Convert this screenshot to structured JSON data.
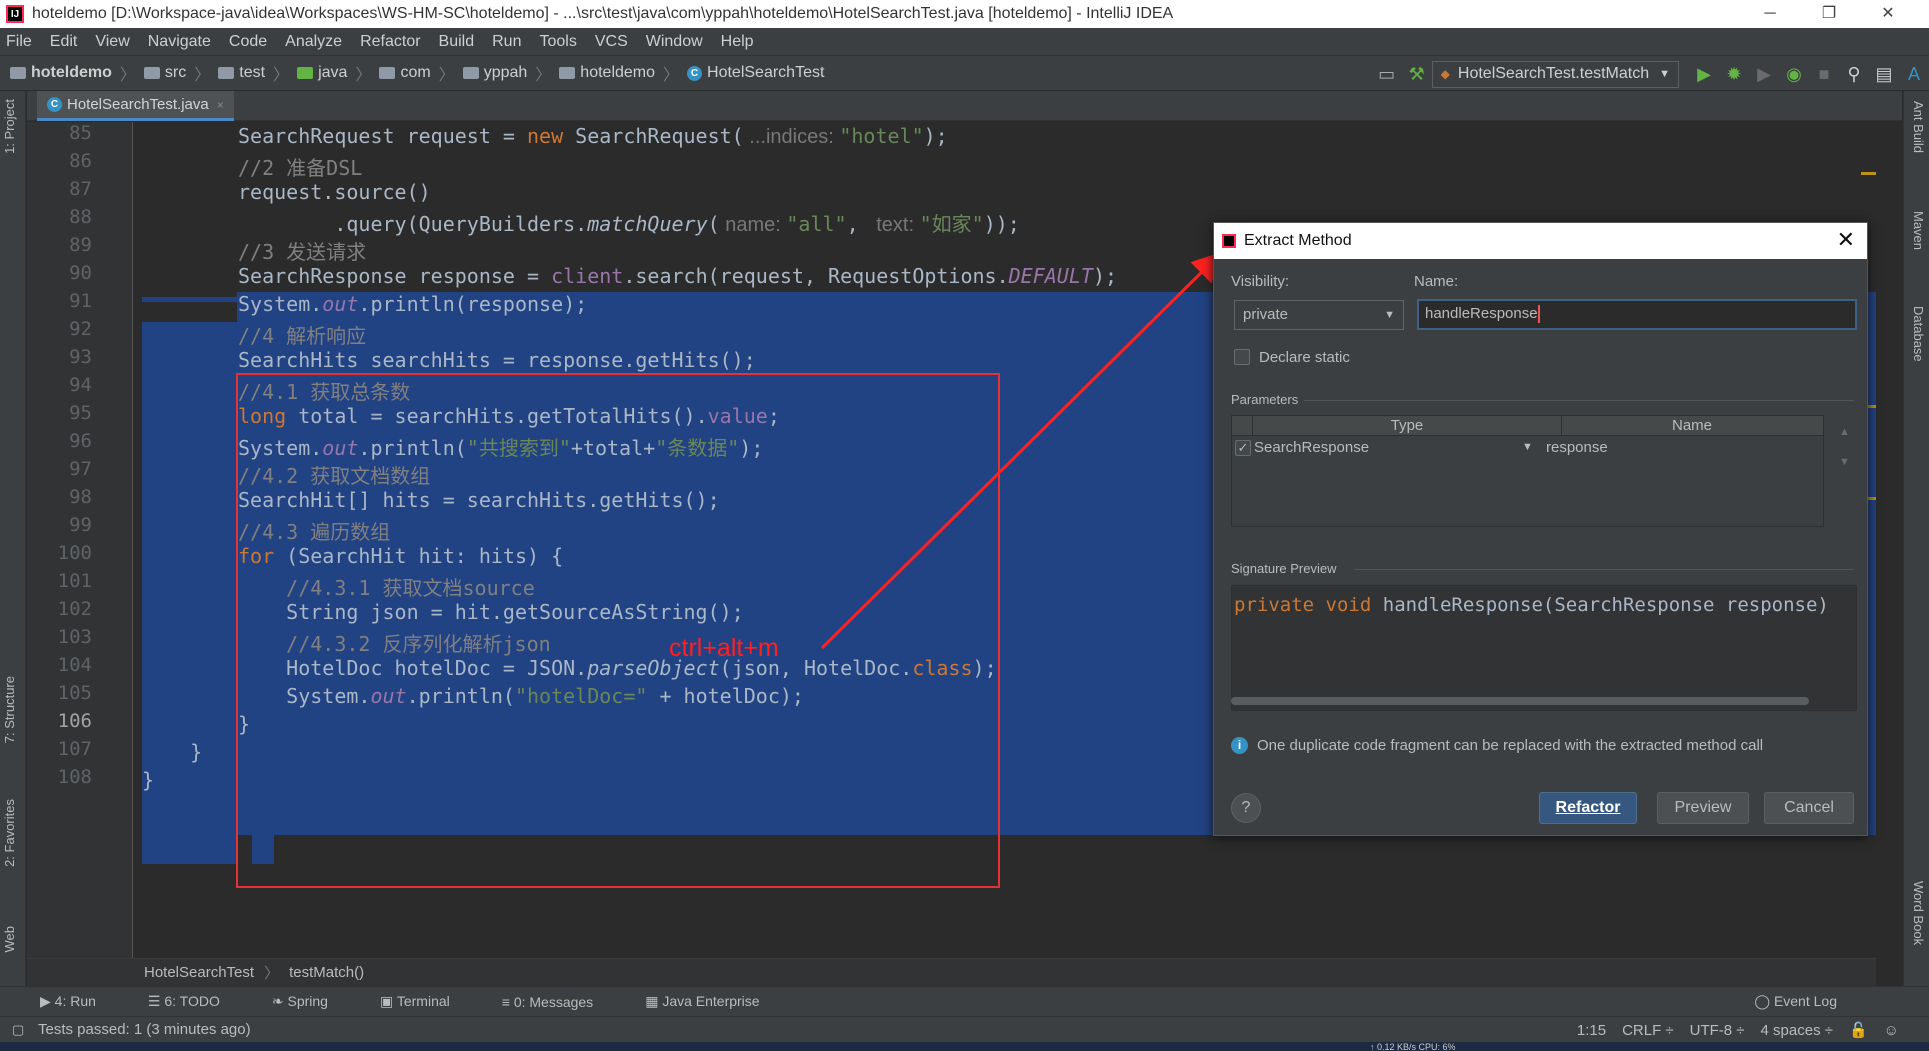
{
  "window": {
    "title": "hoteldemo [D:\\Workspace-java\\idea\\Workspaces\\WS-HM-SC\\hoteldemo] - ...\\src\\test\\java\\com\\yppah\\hoteldemo\\HotelSearchTest.java [hoteldemo] - IntelliJ IDEA",
    "minimize": "─",
    "restore": "❐",
    "close": "✕"
  },
  "menu": [
    "File",
    "Edit",
    "View",
    "Navigate",
    "Code",
    "Analyze",
    "Refactor",
    "Build",
    "Run",
    "Tools",
    "VCS",
    "Window",
    "Help"
  ],
  "breadcrumbs": [
    "hoteldemo",
    "src",
    "test",
    "java",
    "com",
    "yppah",
    "hoteldemo",
    "HotelSearchTest"
  ],
  "run_config": "HotelSearchTest.testMatch",
  "tab": {
    "label": "HotelSearchTest.java",
    "close": "×"
  },
  "left_tool_windows": [
    "1: Project",
    "7: Structure",
    "2: Favorites",
    "Web"
  ],
  "right_tool_windows": [
    "Ant Build",
    "Maven",
    "Database",
    "Word Book"
  ],
  "line_numbers": [
    "85",
    "86",
    "87",
    "88",
    "89",
    "90",
    "91",
    "92",
    "93",
    "94",
    "95",
    "96",
    "97",
    "98",
    "99",
    "100",
    "101",
    "102",
    "103",
    "104",
    "105",
    "106",
    "107",
    "108"
  ],
  "code": {
    "l85": {
      "a": "SearchRequest request = ",
      "kw": "new",
      "b": " SearchRequest(",
      "hint": " ...indices: ",
      "str": "\"hotel\"",
      "c": ");"
    },
    "l86": "//2 准备DSL",
    "l87": "request.source()",
    "l88": {
      "a": "        .query(QueryBuilders.",
      "fn": "matchQuery",
      "b": "(",
      "hint1": " name: ",
      "s1": "\"all\"",
      "c": ", ",
      "hint2": " text: ",
      "s2": "\"如家\"",
      "d": "));"
    },
    "l89": "//3 发送请求",
    "l90": {
      "a": "SearchResponse response = ",
      "fld": "client",
      "b": ".search(request, RequestOptions.",
      "fld2": "DEFAULT",
      "c": ");"
    },
    "l91": {
      "a": "System.",
      "fld": "out",
      "b": ".println(response);"
    },
    "l92": "//4 解析响应",
    "l93": "SearchHits searchHits = response.getHits();",
    "l94": "//4.1 获取总条数",
    "l95": {
      "kw": "long",
      "a": " total = searchHits.getTotalHits().",
      "fld": "value",
      "b": ";"
    },
    "l96": {
      "a": "System.",
      "fld": "out",
      "b": ".println(",
      "s1": "\"共搜索到\"",
      "c": "+total+",
      "s2": "\"条数据\"",
      "d": ");"
    },
    "l97": "//4.2 获取文档数组",
    "l98": "SearchHit[] hits = searchHits.getHits();",
    "l99": "//4.3 遍历数组",
    "l100": {
      "kw": "for",
      "a": " (SearchHit hit: hits) {"
    },
    "l101": "    //4.3.1 获取文档source",
    "l102": "    String json = hit.getSourceAsString();",
    "l103": "    //4.3.2 反序列化解析json",
    "l104": {
      "a": "    HotelDoc hotelDoc = JSON.",
      "fn": "parseObject",
      "b": "(json, HotelDoc.",
      "kw": "class",
      "c": ");"
    },
    "l105": {
      "a": "    System.",
      "fld": "out",
      "b": ".println(",
      "s": "\"hotelDoc=\"",
      "c": " + hotelDoc);"
    },
    "l106": "}",
    "l107": "    }",
    "l108": "}"
  },
  "annotation": "ctrl+alt+m",
  "editor_breadcrumb": [
    "HotelSearchTest",
    "testMatch()"
  ],
  "dialog": {
    "title": "Extract Method",
    "close": "✕",
    "visibility_label": "Visibility:",
    "visibility_value": "private",
    "name_label": "Name:",
    "name_value": "handleResponse",
    "declare_static": "Declare static",
    "parameters_label": "Parameters",
    "col_type": "Type",
    "col_name": "Name",
    "param_type": "SearchResponse",
    "param_name": "response",
    "signature_label": "Signature Preview",
    "signature_kw1": "private",
    "signature_kw2": "void",
    "signature_rest": "handleResponse(SearchResponse response)",
    "info": "One duplicate code fragment can be replaced with the extracted method call",
    "help": "?",
    "refactor": "Refactor",
    "preview": "Preview",
    "cancel": "Cancel"
  },
  "bottom_tools": [
    "4: Run",
    "6: TODO",
    "Spring",
    "Terminal",
    "0: Messages",
    "Java Enterprise"
  ],
  "event_log": "Event Log",
  "status": {
    "message": "Tests passed: 1 (3 minutes ago)",
    "position": "1:15",
    "line_sep": "CRLF ÷",
    "encoding": "UTF-8 ÷",
    "indent": "4 spaces ÷"
  },
  "net": "↑ 0.12 KB/s   CPU: 6%",
  "colors": {
    "keyword": "#cc7832",
    "comment": "#808080",
    "string": "#6a8759",
    "field": "#9876aa",
    "selection": "#214283",
    "annotation": "#e53333"
  }
}
